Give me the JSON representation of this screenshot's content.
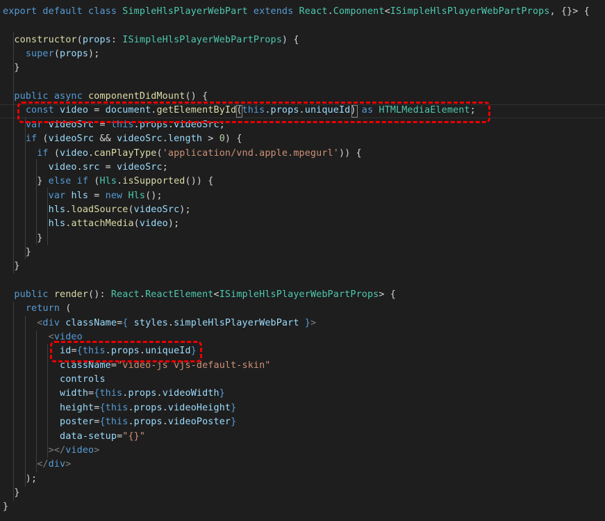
{
  "editor": {
    "lines": [
      [
        [
          "kw",
          "export"
        ],
        [
          "txt",
          " "
        ],
        [
          "kw",
          "default"
        ],
        [
          "txt",
          " "
        ],
        [
          "kw",
          "class"
        ],
        [
          "txt",
          " "
        ],
        [
          "ty",
          "SimpleHlsPlayerWebPart"
        ],
        [
          "txt",
          " "
        ],
        [
          "kw",
          "extends"
        ],
        [
          "txt",
          " "
        ],
        [
          "ty",
          "React"
        ],
        [
          "txt",
          "."
        ],
        [
          "ty",
          "Component"
        ],
        [
          "txt",
          "<"
        ],
        [
          "ty",
          "ISimpleHlsPlayerWebPartProps"
        ],
        [
          "txt",
          ", {}> {"
        ]
      ],
      [],
      [
        [
          "txt",
          "  "
        ],
        [
          "fn",
          "constructor"
        ],
        [
          "txt",
          "("
        ],
        [
          "var",
          "props"
        ],
        [
          "txt",
          ": "
        ],
        [
          "ty",
          "ISimpleHlsPlayerWebPartProps"
        ],
        [
          "txt",
          ") {"
        ]
      ],
      [
        [
          "txt",
          "    "
        ],
        [
          "kw",
          "super"
        ],
        [
          "txt",
          "("
        ],
        [
          "var",
          "props"
        ],
        [
          "txt",
          ");"
        ]
      ],
      [
        [
          "txt",
          "  }"
        ]
      ],
      [],
      [
        [
          "txt",
          "  "
        ],
        [
          "kw",
          "public"
        ],
        [
          "txt",
          " "
        ],
        [
          "kw",
          "async"
        ],
        [
          "txt",
          " "
        ],
        [
          "fn",
          "componentDidMount"
        ],
        [
          "txt",
          "() {"
        ]
      ],
      [
        [
          "txt",
          "    "
        ],
        [
          "kw",
          "const"
        ],
        [
          "txt",
          " "
        ],
        [
          "var",
          "video"
        ],
        [
          "txt",
          " = "
        ],
        [
          "var",
          "document"
        ],
        [
          "txt",
          "."
        ],
        [
          "fn",
          "getElementById"
        ],
        [
          "txt",
          "("
        ],
        [
          "kw",
          "this"
        ],
        [
          "txt",
          "."
        ],
        [
          "var",
          "props"
        ],
        [
          "txt",
          "."
        ],
        [
          "var",
          "uniqueId"
        ],
        [
          "txt",
          ") "
        ],
        [
          "kw",
          "as"
        ],
        [
          "txt",
          " "
        ],
        [
          "ty",
          "HTMLMediaElement"
        ],
        [
          "txt",
          ";"
        ]
      ],
      [
        [
          "txt",
          "    "
        ],
        [
          "kw",
          "var"
        ],
        [
          "txt",
          " "
        ],
        [
          "var",
          "videoSrc"
        ],
        [
          "txt",
          " = "
        ],
        [
          "kw",
          "this"
        ],
        [
          "txt",
          "."
        ],
        [
          "var",
          "props"
        ],
        [
          "txt",
          "."
        ],
        [
          "var",
          "videoSrc"
        ],
        [
          "txt",
          ";"
        ]
      ],
      [
        [
          "txt",
          "    "
        ],
        [
          "kw",
          "if"
        ],
        [
          "txt",
          " ("
        ],
        [
          "var",
          "videoSrc"
        ],
        [
          "txt",
          " && "
        ],
        [
          "var",
          "videoSrc"
        ],
        [
          "txt",
          "."
        ],
        [
          "var",
          "length"
        ],
        [
          "txt",
          " > "
        ],
        [
          "num",
          "0"
        ],
        [
          "txt",
          ") {"
        ]
      ],
      [
        [
          "txt",
          "      "
        ],
        [
          "kw",
          "if"
        ],
        [
          "txt",
          " ("
        ],
        [
          "var",
          "video"
        ],
        [
          "txt",
          "."
        ],
        [
          "fn",
          "canPlayType"
        ],
        [
          "txt",
          "("
        ],
        [
          "str",
          "'application/vnd.apple.mpegurl'"
        ],
        [
          "txt",
          ")) {"
        ]
      ],
      [
        [
          "txt",
          "        "
        ],
        [
          "var",
          "video"
        ],
        [
          "txt",
          "."
        ],
        [
          "var",
          "src"
        ],
        [
          "txt",
          " = "
        ],
        [
          "var",
          "videoSrc"
        ],
        [
          "txt",
          ";"
        ]
      ],
      [
        [
          "txt",
          "      } "
        ],
        [
          "kw",
          "else"
        ],
        [
          "txt",
          " "
        ],
        [
          "kw",
          "if"
        ],
        [
          "txt",
          " ("
        ],
        [
          "ty",
          "Hls"
        ],
        [
          "txt",
          "."
        ],
        [
          "fn",
          "isSupported"
        ],
        [
          "txt",
          "()) {"
        ]
      ],
      [
        [
          "txt",
          "        "
        ],
        [
          "kw",
          "var"
        ],
        [
          "txt",
          " "
        ],
        [
          "var",
          "hls"
        ],
        [
          "txt",
          " = "
        ],
        [
          "kw",
          "new"
        ],
        [
          "txt",
          " "
        ],
        [
          "ty",
          "Hls"
        ],
        [
          "txt",
          "();"
        ]
      ],
      [
        [
          "txt",
          "        "
        ],
        [
          "var",
          "hls"
        ],
        [
          "txt",
          "."
        ],
        [
          "fn",
          "loadSource"
        ],
        [
          "txt",
          "("
        ],
        [
          "var",
          "videoSrc"
        ],
        [
          "txt",
          ");"
        ]
      ],
      [
        [
          "txt",
          "        "
        ],
        [
          "var",
          "hls"
        ],
        [
          "txt",
          "."
        ],
        [
          "fn",
          "attachMedia"
        ],
        [
          "txt",
          "("
        ],
        [
          "var",
          "video"
        ],
        [
          "txt",
          ");"
        ]
      ],
      [
        [
          "txt",
          "      }"
        ]
      ],
      [
        [
          "txt",
          "    }"
        ]
      ],
      [
        [
          "txt",
          "  }"
        ]
      ],
      [],
      [
        [
          "txt",
          "  "
        ],
        [
          "kw",
          "public"
        ],
        [
          "txt",
          " "
        ],
        [
          "fn",
          "render"
        ],
        [
          "txt",
          "(): "
        ],
        [
          "ty",
          "React"
        ],
        [
          "txt",
          "."
        ],
        [
          "ty",
          "ReactElement"
        ],
        [
          "txt",
          "<"
        ],
        [
          "ty",
          "ISimpleHlsPlayerWebPartProps"
        ],
        [
          "txt",
          "> {"
        ]
      ],
      [
        [
          "txt",
          "    "
        ],
        [
          "kw",
          "return"
        ],
        [
          "txt",
          " ("
        ]
      ],
      [
        [
          "txt",
          "      "
        ],
        [
          "tag",
          "<"
        ],
        [
          "kw",
          "div"
        ],
        [
          "txt",
          " "
        ],
        [
          "var",
          "className"
        ],
        [
          "txt",
          "="
        ],
        [
          "kw",
          "{"
        ],
        [
          "txt",
          " "
        ],
        [
          "var",
          "styles"
        ],
        [
          "txt",
          "."
        ],
        [
          "var",
          "simpleHlsPlayerWebPart"
        ],
        [
          "txt",
          " "
        ],
        [
          "kw",
          "}"
        ],
        [
          "tag",
          ">"
        ]
      ],
      [
        [
          "txt",
          "        "
        ],
        [
          "tag",
          "<"
        ],
        [
          "kw",
          "video"
        ]
      ],
      [
        [
          "txt",
          "          "
        ],
        [
          "var",
          "id"
        ],
        [
          "txt",
          "="
        ],
        [
          "kw",
          "{"
        ],
        [
          "kw",
          "this"
        ],
        [
          "txt",
          "."
        ],
        [
          "var",
          "props"
        ],
        [
          "txt",
          "."
        ],
        [
          "var",
          "uniqueId"
        ],
        [
          "kw",
          "}"
        ]
      ],
      [
        [
          "txt",
          "          "
        ],
        [
          "var",
          "className"
        ],
        [
          "txt",
          "="
        ],
        [
          "str",
          "\"video-js vjs-default-skin\""
        ]
      ],
      [
        [
          "txt",
          "          "
        ],
        [
          "var",
          "controls"
        ]
      ],
      [
        [
          "txt",
          "          "
        ],
        [
          "var",
          "width"
        ],
        [
          "txt",
          "="
        ],
        [
          "kw",
          "{"
        ],
        [
          "kw",
          "this"
        ],
        [
          "txt",
          "."
        ],
        [
          "var",
          "props"
        ],
        [
          "txt",
          "."
        ],
        [
          "var",
          "videoWidth"
        ],
        [
          "kw",
          "}"
        ]
      ],
      [
        [
          "txt",
          "          "
        ],
        [
          "var",
          "height"
        ],
        [
          "txt",
          "="
        ],
        [
          "kw",
          "{"
        ],
        [
          "kw",
          "this"
        ],
        [
          "txt",
          "."
        ],
        [
          "var",
          "props"
        ],
        [
          "txt",
          "."
        ],
        [
          "var",
          "videoHeight"
        ],
        [
          "kw",
          "}"
        ]
      ],
      [
        [
          "txt",
          "          "
        ],
        [
          "var",
          "poster"
        ],
        [
          "txt",
          "="
        ],
        [
          "kw",
          "{"
        ],
        [
          "kw",
          "this"
        ],
        [
          "txt",
          "."
        ],
        [
          "var",
          "props"
        ],
        [
          "txt",
          "."
        ],
        [
          "var",
          "videoPoster"
        ],
        [
          "kw",
          "}"
        ]
      ],
      [
        [
          "txt",
          "          "
        ],
        [
          "var",
          "data-setup"
        ],
        [
          "txt",
          "="
        ],
        [
          "str",
          "\"{}\""
        ]
      ],
      [
        [
          "txt",
          "        "
        ],
        [
          "tag",
          "></"
        ],
        [
          "kw",
          "video"
        ],
        [
          "tag",
          ">"
        ]
      ],
      [
        [
          "txt",
          "      "
        ],
        [
          "tag",
          "</"
        ],
        [
          "kw",
          "div"
        ],
        [
          "tag",
          ">"
        ]
      ],
      [
        [
          "txt",
          "    );"
        ]
      ],
      [
        [
          "txt",
          "  }"
        ]
      ],
      [
        [
          "txt",
          "}"
        ]
      ]
    ]
  },
  "colors": {
    "background": "#1e1e1e",
    "keyword": "#569cd6",
    "type": "#4ec9b0",
    "function": "#dcdcaa",
    "variable": "#9cdcfe",
    "string": "#ce9178",
    "number": "#b5cea8",
    "text": "#d4d4d4",
    "annotation": "#ee0000"
  }
}
